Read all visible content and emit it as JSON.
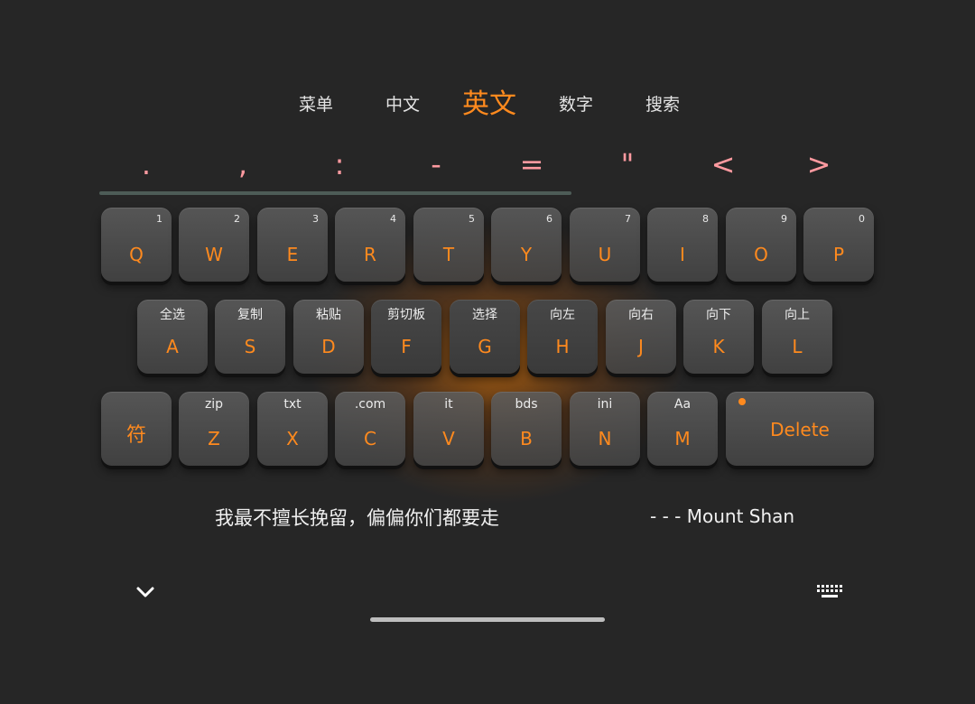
{
  "tabs": [
    {
      "label": "菜单",
      "active": false
    },
    {
      "label": "中文",
      "active": false
    },
    {
      "label": "英文",
      "active": true
    },
    {
      "label": "数字",
      "active": false
    },
    {
      "label": "搜索",
      "active": false
    }
  ],
  "symbols": [
    ".",
    ",",
    ":",
    "-",
    "=",
    "\"",
    "<",
    ">"
  ],
  "symbol_scroll_progress": 0.61,
  "row1": [
    {
      "key": "Q",
      "num": "1"
    },
    {
      "key": "W",
      "num": "2"
    },
    {
      "key": "E",
      "num": "3"
    },
    {
      "key": "R",
      "num": "4"
    },
    {
      "key": "T",
      "num": "5"
    },
    {
      "key": "Y",
      "num": "6"
    },
    {
      "key": "U",
      "num": "7"
    },
    {
      "key": "I",
      "num": "8"
    },
    {
      "key": "O",
      "num": "9"
    },
    {
      "key": "P",
      "num": "0"
    }
  ],
  "row2": [
    {
      "key": "A",
      "hint": "全选"
    },
    {
      "key": "S",
      "hint": "复制"
    },
    {
      "key": "D",
      "hint": "粘贴"
    },
    {
      "key": "F",
      "hint": "剪切板"
    },
    {
      "key": "G",
      "hint": "选择"
    },
    {
      "key": "H",
      "hint": "向左"
    },
    {
      "key": "J",
      "hint": "向右"
    },
    {
      "key": "K",
      "hint": "向下"
    },
    {
      "key": "L",
      "hint": "向上"
    }
  ],
  "row3": {
    "symbol_key": "符",
    "keys": [
      {
        "key": "Z",
        "hint": "zip"
      },
      {
        "key": "X",
        "hint": "txt"
      },
      {
        "key": "C",
        "hint": ".com"
      },
      {
        "key": "V",
        "hint": "it"
      },
      {
        "key": "B",
        "hint": "bds"
      },
      {
        "key": "N",
        "hint": "ini"
      },
      {
        "key": "M",
        "hint": "Aa"
      }
    ],
    "delete_label": "Delete"
  },
  "quote": {
    "text": "我最不擅长挽留，偏偏你们都要走",
    "author": "- - - Mount Shan"
  },
  "colors": {
    "accent": "#ff8a1e",
    "symbol": "#ff9aa0",
    "background": "#262626"
  },
  "icons": {
    "collapse": "chevron-down-icon",
    "keyboard": "keyboard-icon"
  }
}
